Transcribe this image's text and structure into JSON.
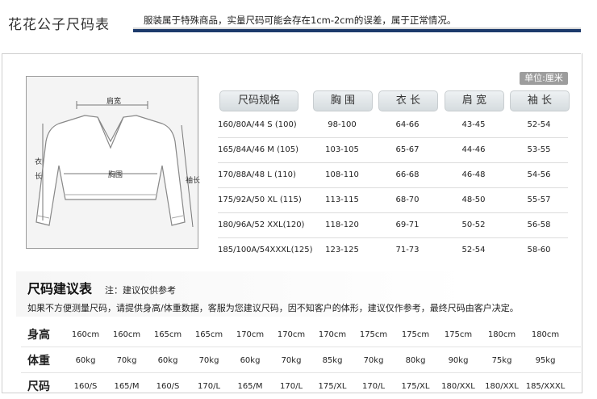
{
  "header": {
    "brand": "花花公子尺码表",
    "notice": "服装属于特殊商品，实量尺码可能会存在1cm-2cm的误差，属于正常情况。"
  },
  "unit_label": "单位:厘米",
  "figure": {
    "shoulder_label": "肩宽",
    "chest_label": "胸围",
    "length_label": "衣长",
    "sleeve_label": "袖长"
  },
  "size_table": {
    "headers": [
      "尺码规格",
      "胸 围",
      "衣 长",
      "肩 宽",
      "袖 长"
    ],
    "rows": [
      [
        "160/80A/44  S  (100)",
        "98-100",
        "64-66",
        "43-45",
        "52-54"
      ],
      [
        "165/84A/46  M  (105)",
        "103-105",
        "65-67",
        "44-46",
        "53-55"
      ],
      [
        "170/88A/48  L  (110)",
        "108-110",
        "66-68",
        "46-48",
        "54-56"
      ],
      [
        "175/92A/50  XL (115)",
        "113-115",
        "68-70",
        "48-50",
        "55-57"
      ],
      [
        "180/96A/52 XXL(120)",
        "118-120",
        "69-71",
        "50-52",
        "56-58"
      ],
      [
        "185/100A/54XXXL(125)",
        "123-125",
        "71-73",
        "52-54",
        "58-60"
      ]
    ]
  },
  "suggestion": {
    "title": "尺码建议表",
    "subtitle": "注：建议仅供参考",
    "description": "如果不方便测量尺码，请提供身高/体重数据，客服为您建议尺码，因不知客户的体形，建议仅作参考，最终尺码由客户决定。",
    "rows": [
      {
        "label": "身高",
        "values": [
          "160cm",
          "160cm",
          "165cm",
          "165cm",
          "170cm",
          "170cm",
          "170cm",
          "175cm",
          "175cm",
          "175cm",
          "180cm",
          "180cm"
        ]
      },
      {
        "label": "体重",
        "values": [
          "60kg",
          "70kg",
          "60kg",
          "70kg",
          "60kg",
          "70kg",
          "85kg",
          "70kg",
          "80kg",
          "90kg",
          "75kg",
          "95kg"
        ]
      },
      {
        "label": "尺码",
        "values": [
          "160/S",
          "165/M",
          "160/S",
          "170/L",
          "165/M",
          "170/L",
          "175/XL",
          "170/L",
          "175/XL",
          "180/XXL",
          "180/XXL",
          "185/XXXL"
        ]
      }
    ]
  }
}
